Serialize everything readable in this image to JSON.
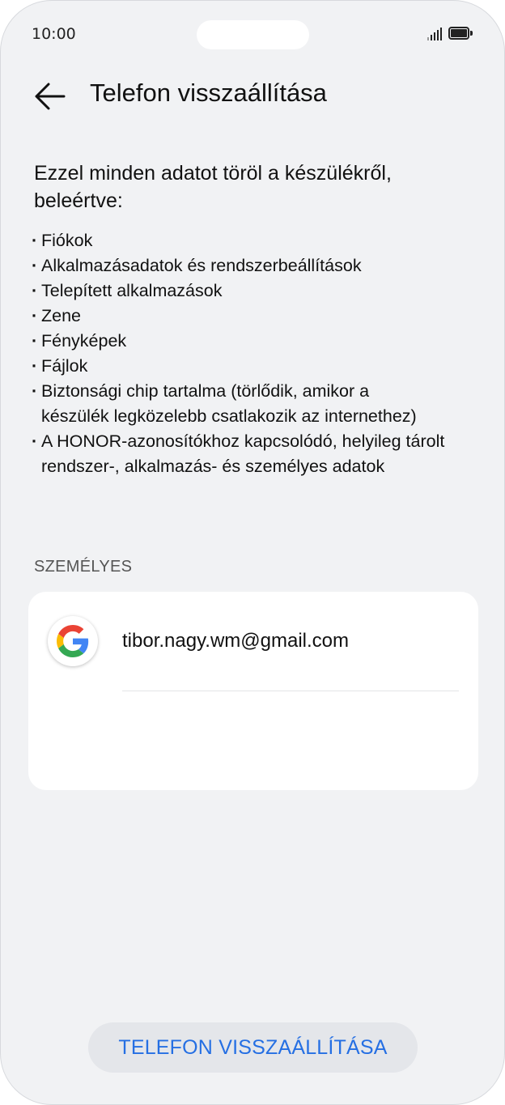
{
  "status_bar": {
    "time": "10:00"
  },
  "header": {
    "title": "Telefon visszaállítása"
  },
  "intro": "Ezzel minden adatot töröl a készülékről, beleértve:",
  "items": [
    "Fiókok",
    "Alkalmazásadatok és rendszerbeállítások",
    "Telepített alkalmazások",
    "Zene",
    "Fényképek",
    "Fájlok",
    "Biztonsági chip tartalma (törlődik, amikor a készülék legközelebb csatlakozik az internethez)",
    "A HONOR-azonosítókhoz kapcsolódó, helyileg tárolt rendszer-, alkalmazás- és személyes adatok"
  ],
  "section_label": "SZEMÉLYES",
  "account": {
    "email": "tibor.nagy.wm@gmail.com",
    "icon": "google-icon"
  },
  "reset_button": {
    "label": "TELEFON VISSZAÁLLÍTÁSA"
  },
  "colors": {
    "accent": "#256fe3",
    "background": "#f1f2f4",
    "card": "#ffffff"
  }
}
